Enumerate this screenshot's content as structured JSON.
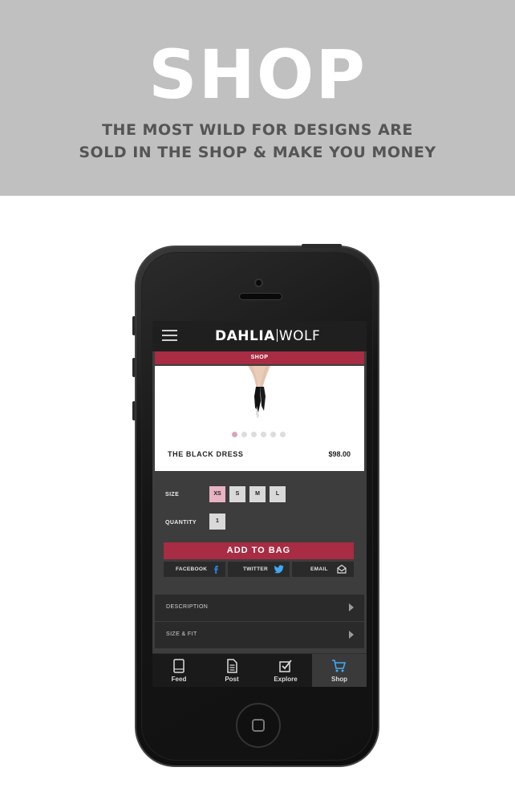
{
  "banner": {
    "title": "SHOP",
    "subtitle_line1": "THE MOST WILD FOR DESIGNS ARE",
    "subtitle_line2": "SOLD IN THE SHOP & MAKE YOU MONEY"
  },
  "app": {
    "brand_left": "DAHLIA",
    "brand_right": "WOLF",
    "section_title": "SHOP",
    "product": {
      "name": "THE BLACK DRESS",
      "price": "$98.00",
      "carousel_total": 6,
      "carousel_active": 1
    },
    "size": {
      "label": "SIZE",
      "options": [
        "XS",
        "S",
        "M",
        "L"
      ],
      "selected": "XS"
    },
    "quantity": {
      "label": "QUANTITY",
      "value": "1"
    },
    "add_to_bag": "ADD TO BAG",
    "share": [
      {
        "label": "FACEBOOK",
        "icon": "facebook-icon"
      },
      {
        "label": "TWITTER",
        "icon": "twitter-icon"
      },
      {
        "label": "EMAIL",
        "icon": "email-icon"
      }
    ],
    "accordion": [
      {
        "label": "DESCRIPTION"
      },
      {
        "label": "SIZE & FIT"
      }
    ],
    "tabs": [
      {
        "label": "Feed",
        "icon": "tablet-icon"
      },
      {
        "label": "Post",
        "icon": "document-icon"
      },
      {
        "label": "Explore",
        "icon": "checkbox-icon"
      },
      {
        "label": "Shop",
        "icon": "cart-icon"
      }
    ],
    "active_tab": "Shop",
    "colors": {
      "accent": "#a82c43",
      "selected_size": "#e8b3c2",
      "active_dot": "#d9a7b6",
      "cart_icon": "#3fa9f5"
    }
  }
}
